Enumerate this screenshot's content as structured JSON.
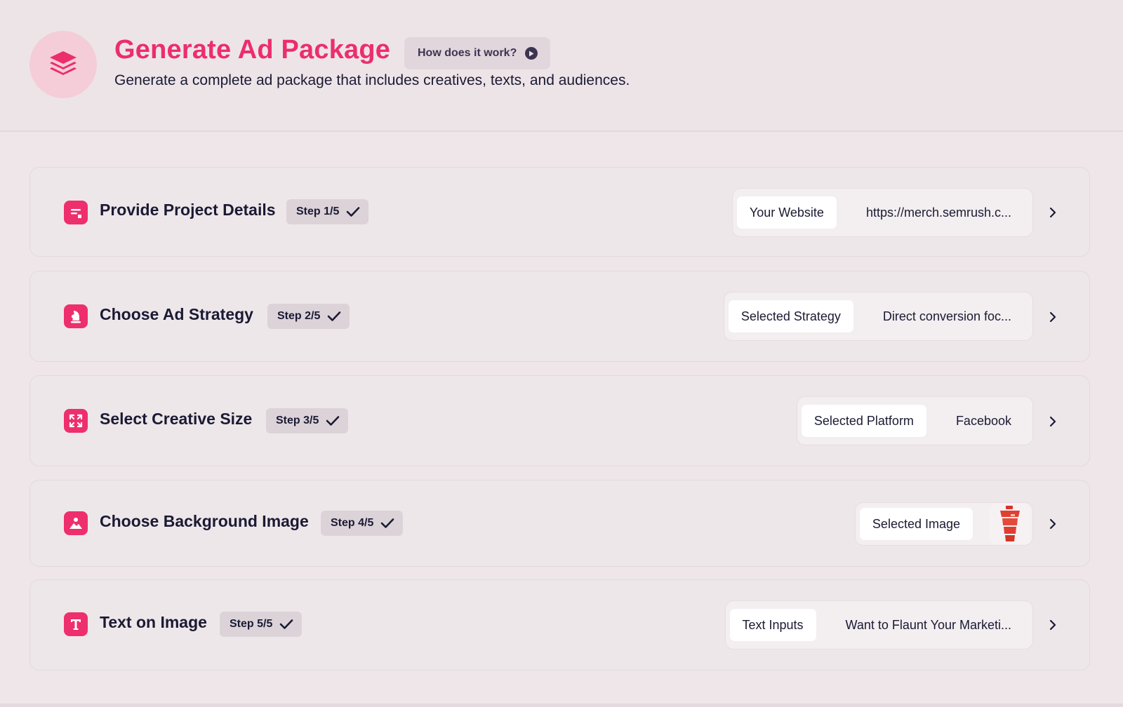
{
  "header": {
    "title": "Generate Ad Package",
    "help_button": "How does it work?",
    "subtitle": "Generate a complete ad package that includes creatives, texts, and audiences.",
    "icon": "layers-icon"
  },
  "colors": {
    "accent": "#ec2d6e",
    "background": "#eee6e9",
    "badge": "#dcd3d9"
  },
  "steps": [
    {
      "title": "Provide Project Details",
      "badge": "Step 1/5",
      "icon": "form-icon",
      "summary_label": "Your Website",
      "summary_value": "https://merch.semrush.c..."
    },
    {
      "title": "Choose Ad Strategy",
      "badge": "Step 2/5",
      "icon": "chess-knight-icon",
      "summary_label": "Selected Strategy",
      "summary_value": "Direct conversion foc..."
    },
    {
      "title": "Select Creative Size",
      "badge": "Step 3/5",
      "icon": "resize-icon",
      "summary_label": "Selected Platform",
      "summary_value": "Facebook"
    },
    {
      "title": "Choose Background Image",
      "badge": "Step 4/5",
      "icon": "image-icon",
      "summary_label": "Selected Image",
      "summary_value": ""
    },
    {
      "title": "Text on Image",
      "badge": "Step 5/5",
      "icon": "text-t-icon",
      "summary_label": "Text Inputs",
      "summary_value": "Want to Flaunt Your Marketi..."
    }
  ]
}
